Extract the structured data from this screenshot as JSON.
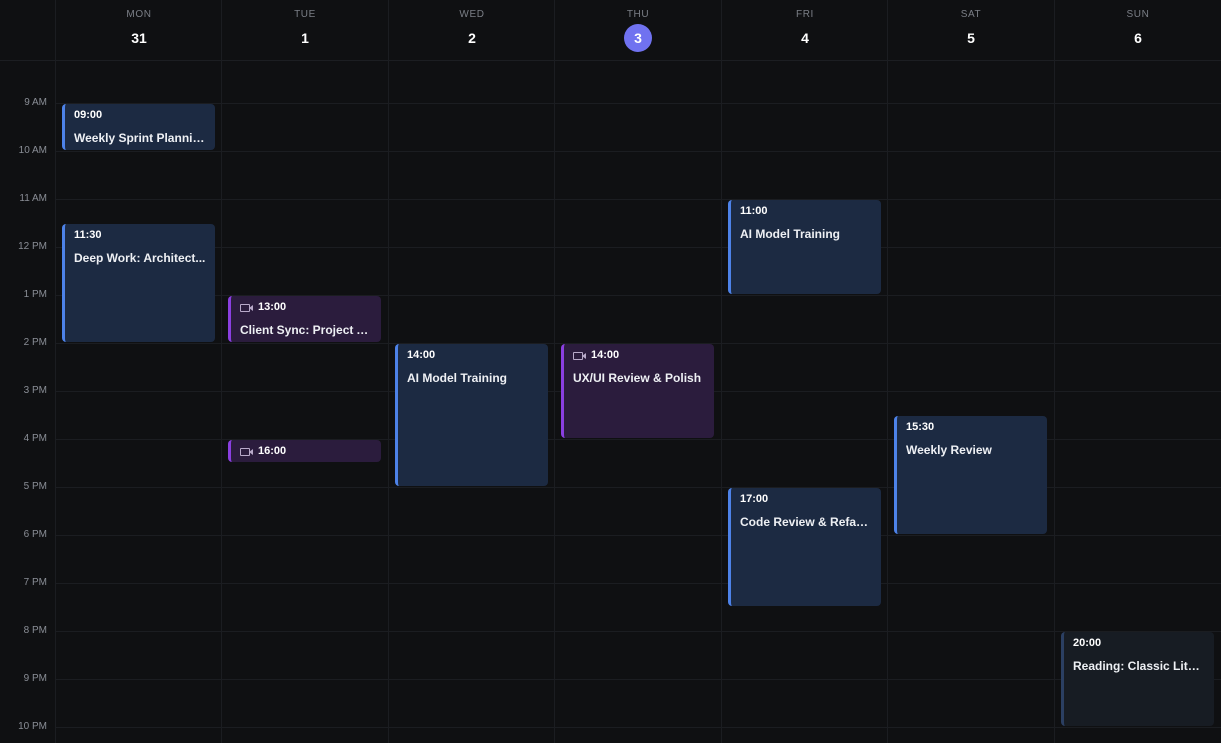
{
  "days": [
    {
      "dow": "MON",
      "num": "31",
      "today": false
    },
    {
      "dow": "TUE",
      "num": "1",
      "today": false
    },
    {
      "dow": "WED",
      "num": "2",
      "today": false
    },
    {
      "dow": "THU",
      "num": "3",
      "today": true
    },
    {
      "dow": "FRI",
      "num": "4",
      "today": false
    },
    {
      "dow": "SAT",
      "num": "5",
      "today": false
    },
    {
      "dow": "SUN",
      "num": "6",
      "today": false
    }
  ],
  "time_labels": [
    "9 AM",
    "10 AM",
    "11 AM",
    "12 PM",
    "1 PM",
    "2 PM",
    "3 PM",
    "4 PM",
    "5 PM",
    "6 PM",
    "7 PM",
    "8 PM",
    "9 PM",
    "10 PM"
  ],
  "events": [
    {
      "day": 0,
      "start": 9,
      "end": 10,
      "time": "09:00",
      "title": "Weekly Sprint Planning",
      "style": "blue",
      "icon": ""
    },
    {
      "day": 0,
      "start": 11.5,
      "end": 14,
      "time": "11:30",
      "title": "Deep Work: Architect...",
      "style": "blue",
      "icon": ""
    },
    {
      "day": 1,
      "start": 13,
      "end": 14,
      "time": "13:00",
      "title": "Client Sync: Project Al...",
      "style": "purple",
      "icon": "video-camera-icon"
    },
    {
      "day": 1,
      "start": 16,
      "end": 16.5,
      "time": "16:00",
      "title": "",
      "style": "purple",
      "icon": "video-camera-icon"
    },
    {
      "day": 2,
      "start": 14,
      "end": 17,
      "time": "14:00",
      "title": "AI Model Training",
      "style": "blue",
      "icon": ""
    },
    {
      "day": 3,
      "start": 14,
      "end": 16,
      "time": "14:00",
      "title": "UX/UI Review & Polish",
      "style": "purple",
      "icon": "video-camera-icon"
    },
    {
      "day": 4,
      "start": 11,
      "end": 13,
      "time": "11:00",
      "title": "AI Model Training",
      "style": "blue",
      "icon": ""
    },
    {
      "day": 4,
      "start": 17,
      "end": 19.5,
      "time": "17:00",
      "title": "Code Review & Refact...",
      "style": "blue",
      "icon": ""
    },
    {
      "day": 5,
      "start": 15.5,
      "end": 18,
      "time": "15:30",
      "title": "Weekly Review",
      "style": "blue",
      "icon": ""
    },
    {
      "day": 6,
      "start": 20,
      "end": 22,
      "time": "20:00",
      "title": "Reading: Classic Liter...",
      "style": "dim",
      "icon": ""
    }
  ]
}
